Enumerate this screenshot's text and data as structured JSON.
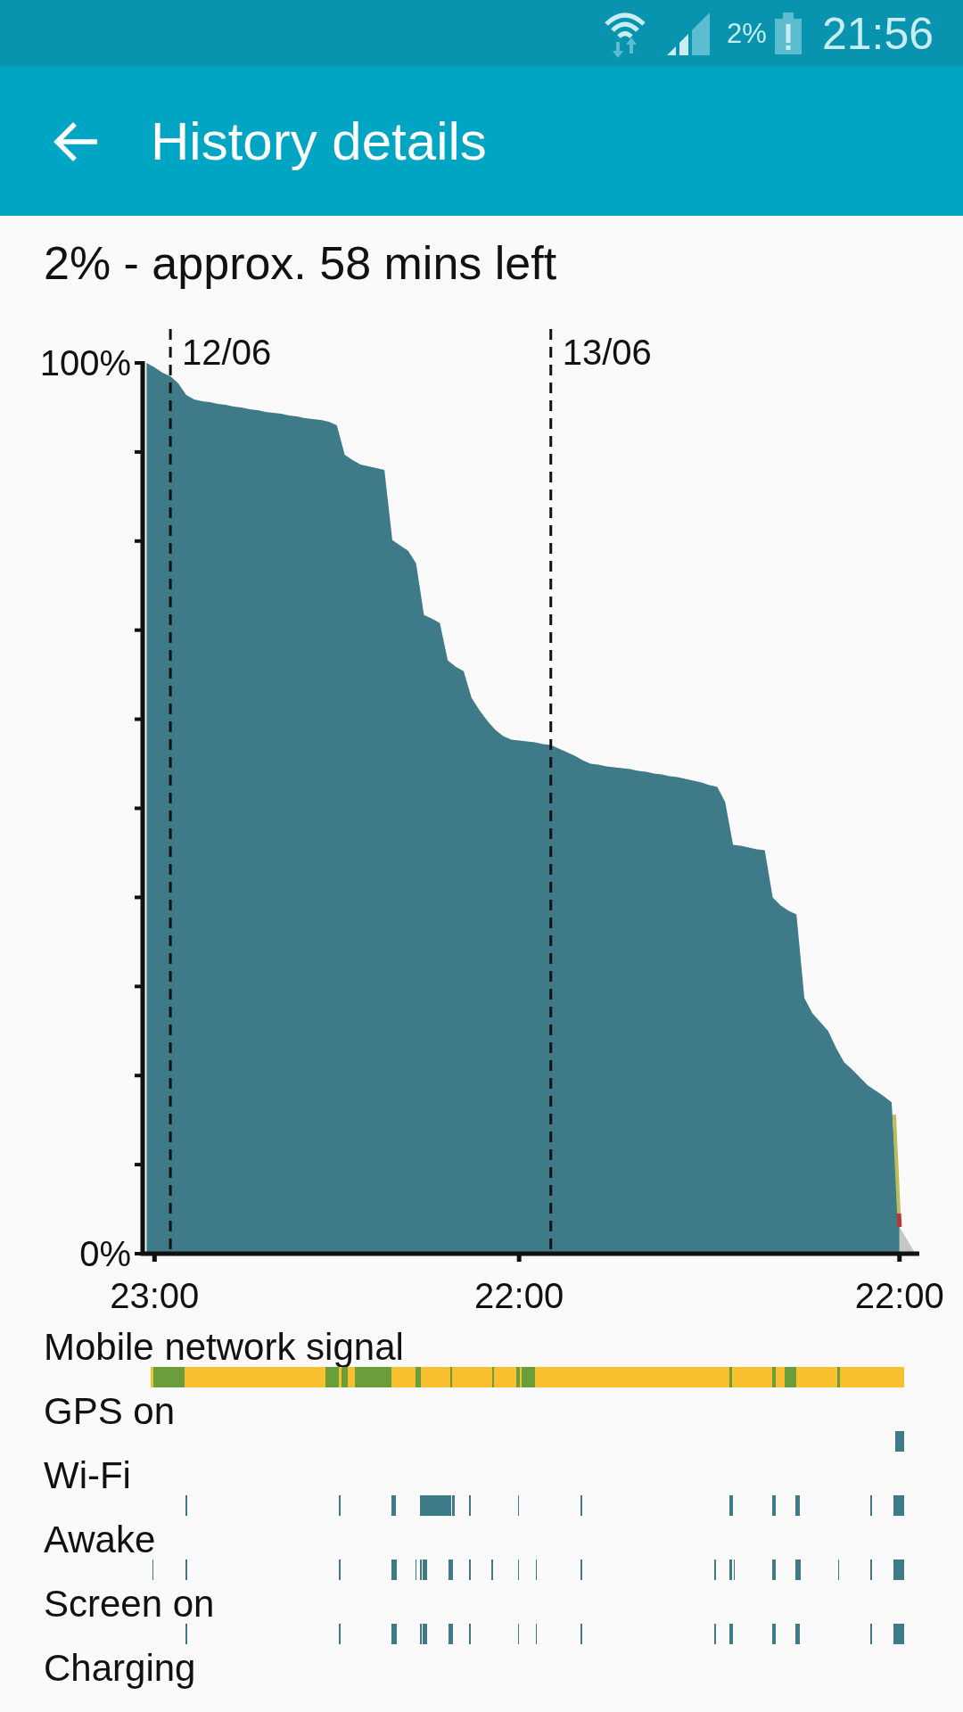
{
  "status_bar": {
    "battery_percent": "2%",
    "time": "21:56"
  },
  "app_bar": {
    "title": "History details"
  },
  "summary": "2% - approx. 58 mins left",
  "battery_chart": {
    "chart_data": {
      "type": "area",
      "categories": [
        null,
        "23:00",
        null,
        null,
        null,
        null,
        null,
        null,
        null,
        null,
        null,
        null,
        null,
        null,
        null,
        null,
        null,
        null,
        null,
        null,
        null,
        null,
        null,
        null,
        null,
        null,
        null,
        null,
        null,
        null,
        null,
        null,
        null,
        null,
        null,
        null,
        null,
        null,
        null,
        null,
        null,
        null,
        null,
        null,
        null,
        null,
        null,
        "22:00",
        null,
        null,
        null,
        null,
        null,
        null,
        null,
        null,
        null,
        null,
        null,
        null,
        null,
        null,
        null,
        null,
        null,
        null,
        null,
        null,
        null,
        null,
        null,
        null,
        null,
        null,
        null,
        null,
        null,
        null,
        null,
        null,
        null,
        null,
        null,
        null,
        null,
        null,
        null,
        null,
        null,
        null,
        null,
        null,
        null,
        null,
        null,
        "22:00",
        null,
        null
      ],
      "series": [
        {
          "color": "#3f7a89",
          "values": [
            100,
            99.5,
            98.9,
            98.5,
            97.7,
            96.4,
            95.9,
            95.7,
            95.6,
            95.4,
            95.3,
            95.1,
            95.0,
            94.8,
            94.7,
            94.5,
            94.4,
            94.3,
            94.1,
            94.0,
            93.8,
            93.7,
            93.6,
            93.4,
            93.0,
            89.7,
            89.1,
            88.6,
            88.4,
            88.2,
            88.0,
            80.1,
            79.5,
            78.9,
            77.5,
            71.7,
            71.3,
            70.8,
            66.6,
            65.9,
            65.4,
            62.4,
            61.0,
            59.8,
            58.8,
            58.1,
            57.7,
            57.6,
            57.5,
            57.4,
            57.2,
            57.1,
            56.7,
            56.3,
            55.9,
            55.4,
            55.0,
            54.9,
            54.7,
            54.6,
            54.5,
            54.4,
            54.2,
            54.1,
            53.9,
            53.8,
            53.6,
            53.5,
            53.3,
            53.1,
            52.9,
            52.6,
            52.4,
            50.7,
            45.9,
            45.8,
            45.6,
            45.4,
            45.3,
            40.0,
            39.1,
            38.5,
            38.1,
            28.7,
            27.0,
            26.0,
            25.0,
            23.1,
            21.5,
            20.7,
            19.8,
            18.9,
            18.3,
            17.7,
            17.0,
            3,
            null,
            null
          ]
        },
        {
          "color": "#c6c6c6",
          "values": [
            null,
            null,
            null,
            null,
            null,
            null,
            null,
            null,
            null,
            null,
            null,
            null,
            null,
            null,
            null,
            null,
            null,
            null,
            null,
            null,
            null,
            null,
            null,
            null,
            null,
            null,
            null,
            null,
            null,
            null,
            null,
            null,
            null,
            null,
            null,
            null,
            null,
            null,
            null,
            null,
            null,
            null,
            null,
            null,
            null,
            null,
            null,
            null,
            null,
            null,
            null,
            null,
            null,
            null,
            null,
            null,
            null,
            null,
            null,
            null,
            null,
            null,
            null,
            null,
            null,
            null,
            null,
            null,
            null,
            null,
            null,
            null,
            null,
            null,
            null,
            null,
            null,
            null,
            null,
            null,
            null,
            null,
            null,
            null,
            null,
            null,
            null,
            null,
            null,
            null,
            null,
            null,
            null,
            null,
            null,
            3,
            null,
            0
          ]
        }
      ],
      "ylim": [
        0,
        100
      ],
      "yticks": [
        {
          "value": 0,
          "label": "0%"
        },
        {
          "value": 100,
          "label": "100%"
        }
      ],
      "annotations": [
        "12/06",
        "13/06"
      ]
    }
  },
  "timelines": [
    {
      "label": "Mobile network signal",
      "kind": "signal"
    },
    {
      "label": "GPS on",
      "kind": "gps"
    },
    {
      "label": "Wi-Fi",
      "kind": "wifi"
    },
    {
      "label": "Awake",
      "kind": "awake"
    },
    {
      "label": "Screen on",
      "kind": "screen"
    },
    {
      "label": "Charging",
      "kind": "charging"
    }
  ]
}
